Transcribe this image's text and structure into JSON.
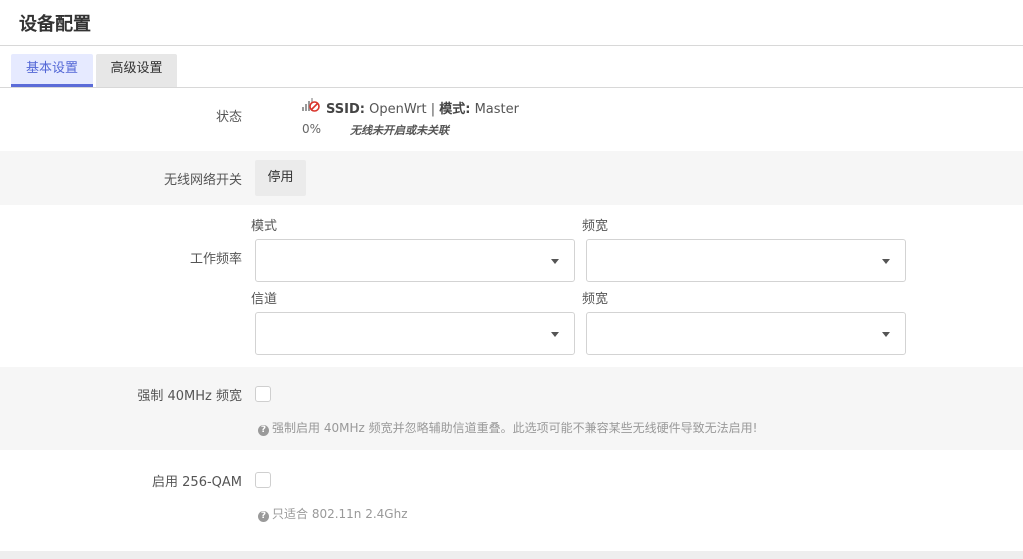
{
  "page": {
    "title": "设备配置"
  },
  "tabs": [
    {
      "label": "基本设置",
      "active": true
    },
    {
      "label": "高级设置",
      "active": false
    }
  ],
  "status": {
    "label": "状态",
    "ssid_key": "SSID:",
    "ssid_value": "OpenWrt",
    "separator": "|",
    "mode_key": "模式:",
    "mode_value": "Master",
    "signal_percent": "0%",
    "note": "无线未开启或未关联",
    "icon": "wifi-disabled-icon"
  },
  "wireless": {
    "label": "无线网络开关",
    "button": "停用"
  },
  "frequency": {
    "label": "工作频率",
    "mode_label": "模式",
    "width_label_1": "频宽",
    "channel_label": "信道",
    "width_label_2": "频宽",
    "mode_value": "",
    "width_value_1": "",
    "channel_value": "",
    "width_value_2": ""
  },
  "force40": {
    "label": "强制 40MHz 频宽",
    "checked": false,
    "help": "强制启用 40MHz 频宽并忽略辅助信道重叠。此选项可能不兼容某些无线硬件导致无法启用!"
  },
  "qam256": {
    "label": "启用 256-QAM",
    "checked": false,
    "help": "只适合 802.11n 2.4Ghz"
  },
  "colors": {
    "accent": "#5b6cd8",
    "active_tab_bg": "#e6eaff",
    "row_gray": "#f6f6f6"
  }
}
